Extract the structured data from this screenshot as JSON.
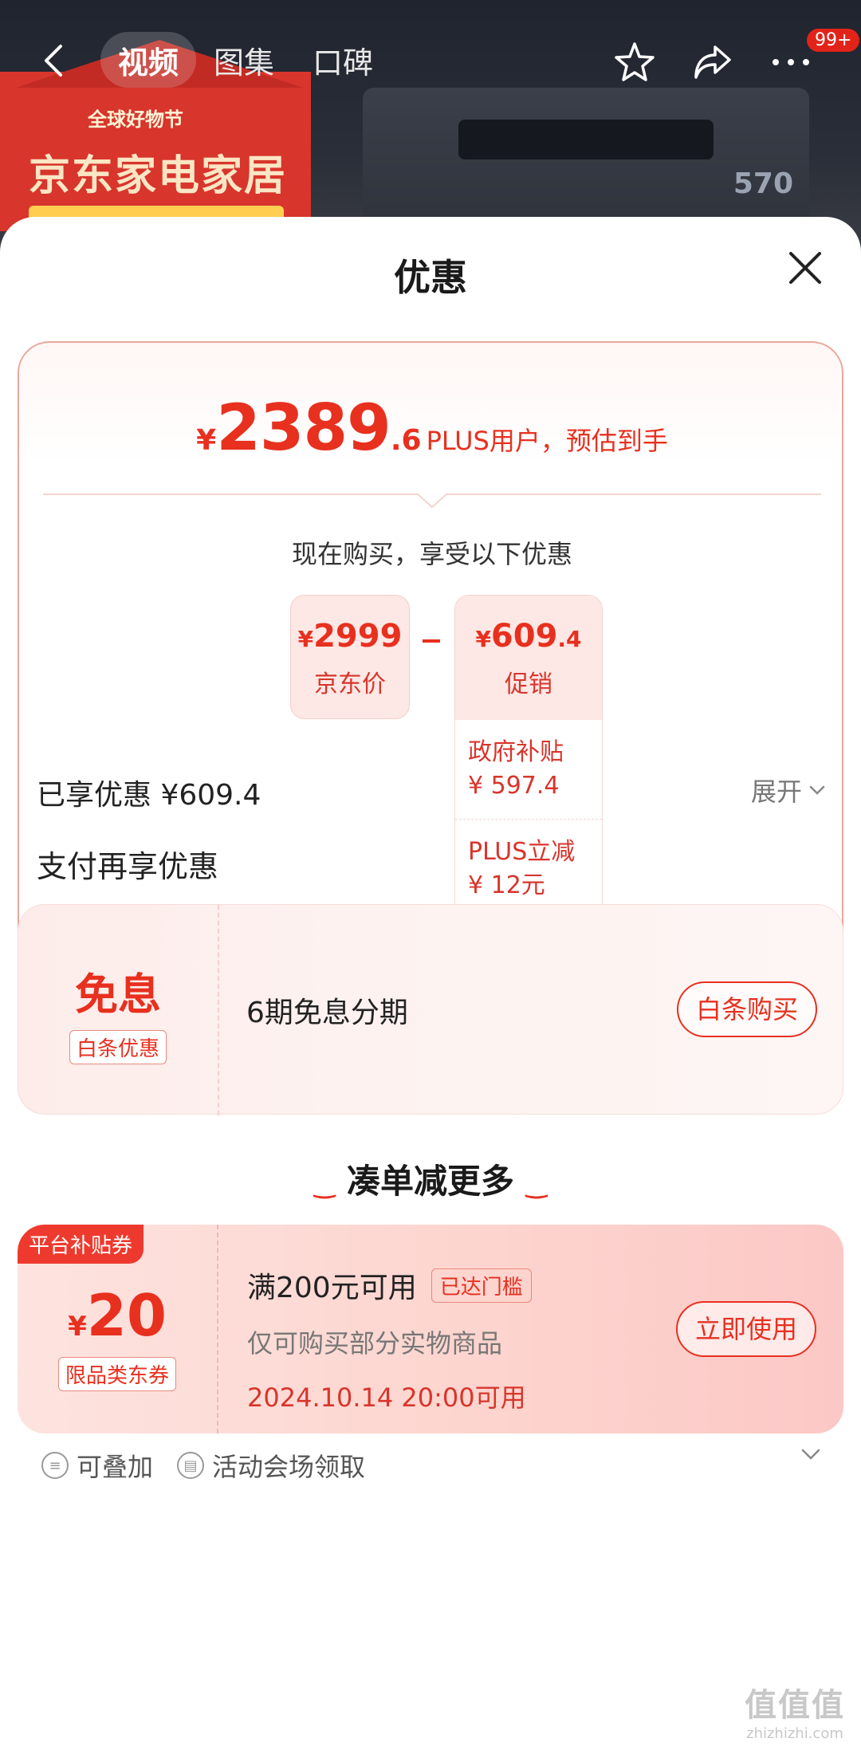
{
  "topbar": {
    "tabs": [
      {
        "label": "视频",
        "active": true
      },
      {
        "label": "图集",
        "active": false
      },
      {
        "label": "口碑",
        "active": false
      }
    ],
    "cart_badge": "99+"
  },
  "hero": {
    "festival_line": "全球好物节",
    "brand_line": "京东家电家居",
    "model_badge": "570"
  },
  "sheet": {
    "title": "优惠",
    "summary": {
      "currency": "¥",
      "price_int": "2389",
      "price_dec": ".6",
      "price_note": "PLUS用户，预估到手",
      "buy_now_text": "现在购买，享受以下优惠",
      "jd_price": {
        "currency": "¥",
        "value": "2999",
        "label": "京东价"
      },
      "promo": {
        "currency": "¥",
        "value": "609",
        "value_dec": ".4",
        "label": "促销",
        "items": [
          {
            "name": "政府补贴",
            "amount": "¥ 597.4"
          },
          {
            "name": "PLUS立减",
            "amount": "¥ 12元"
          }
        ]
      }
    },
    "enjoyed": "已享优惠 ¥609.4",
    "expand_label": "展开",
    "pay_more_title": "支付再享优惠",
    "interest": {
      "big": "免息",
      "tag": "白条优惠",
      "desc": "6期免息分期",
      "button": "白条购买"
    },
    "more_title": "凑单减更多",
    "coupon": {
      "flag": "平台补贴券",
      "currency": "¥",
      "amount": "20",
      "category": "限品类东券",
      "condition": "满200元可用",
      "reached": "已达门槛",
      "scope": "仅可购买部分实物商品",
      "time": "2024.10.14 20:00可用",
      "button": "立即使用"
    },
    "footer": {
      "stackable": "可叠加",
      "venue": "活动会场领取"
    }
  },
  "watermark": {
    "logo": "值值值",
    "url": "zhizhizhi.com"
  },
  "colors": {
    "accent": "#e8301f",
    "sheet_bg": "#ffffff",
    "soft_pink": "#fde8e5"
  }
}
